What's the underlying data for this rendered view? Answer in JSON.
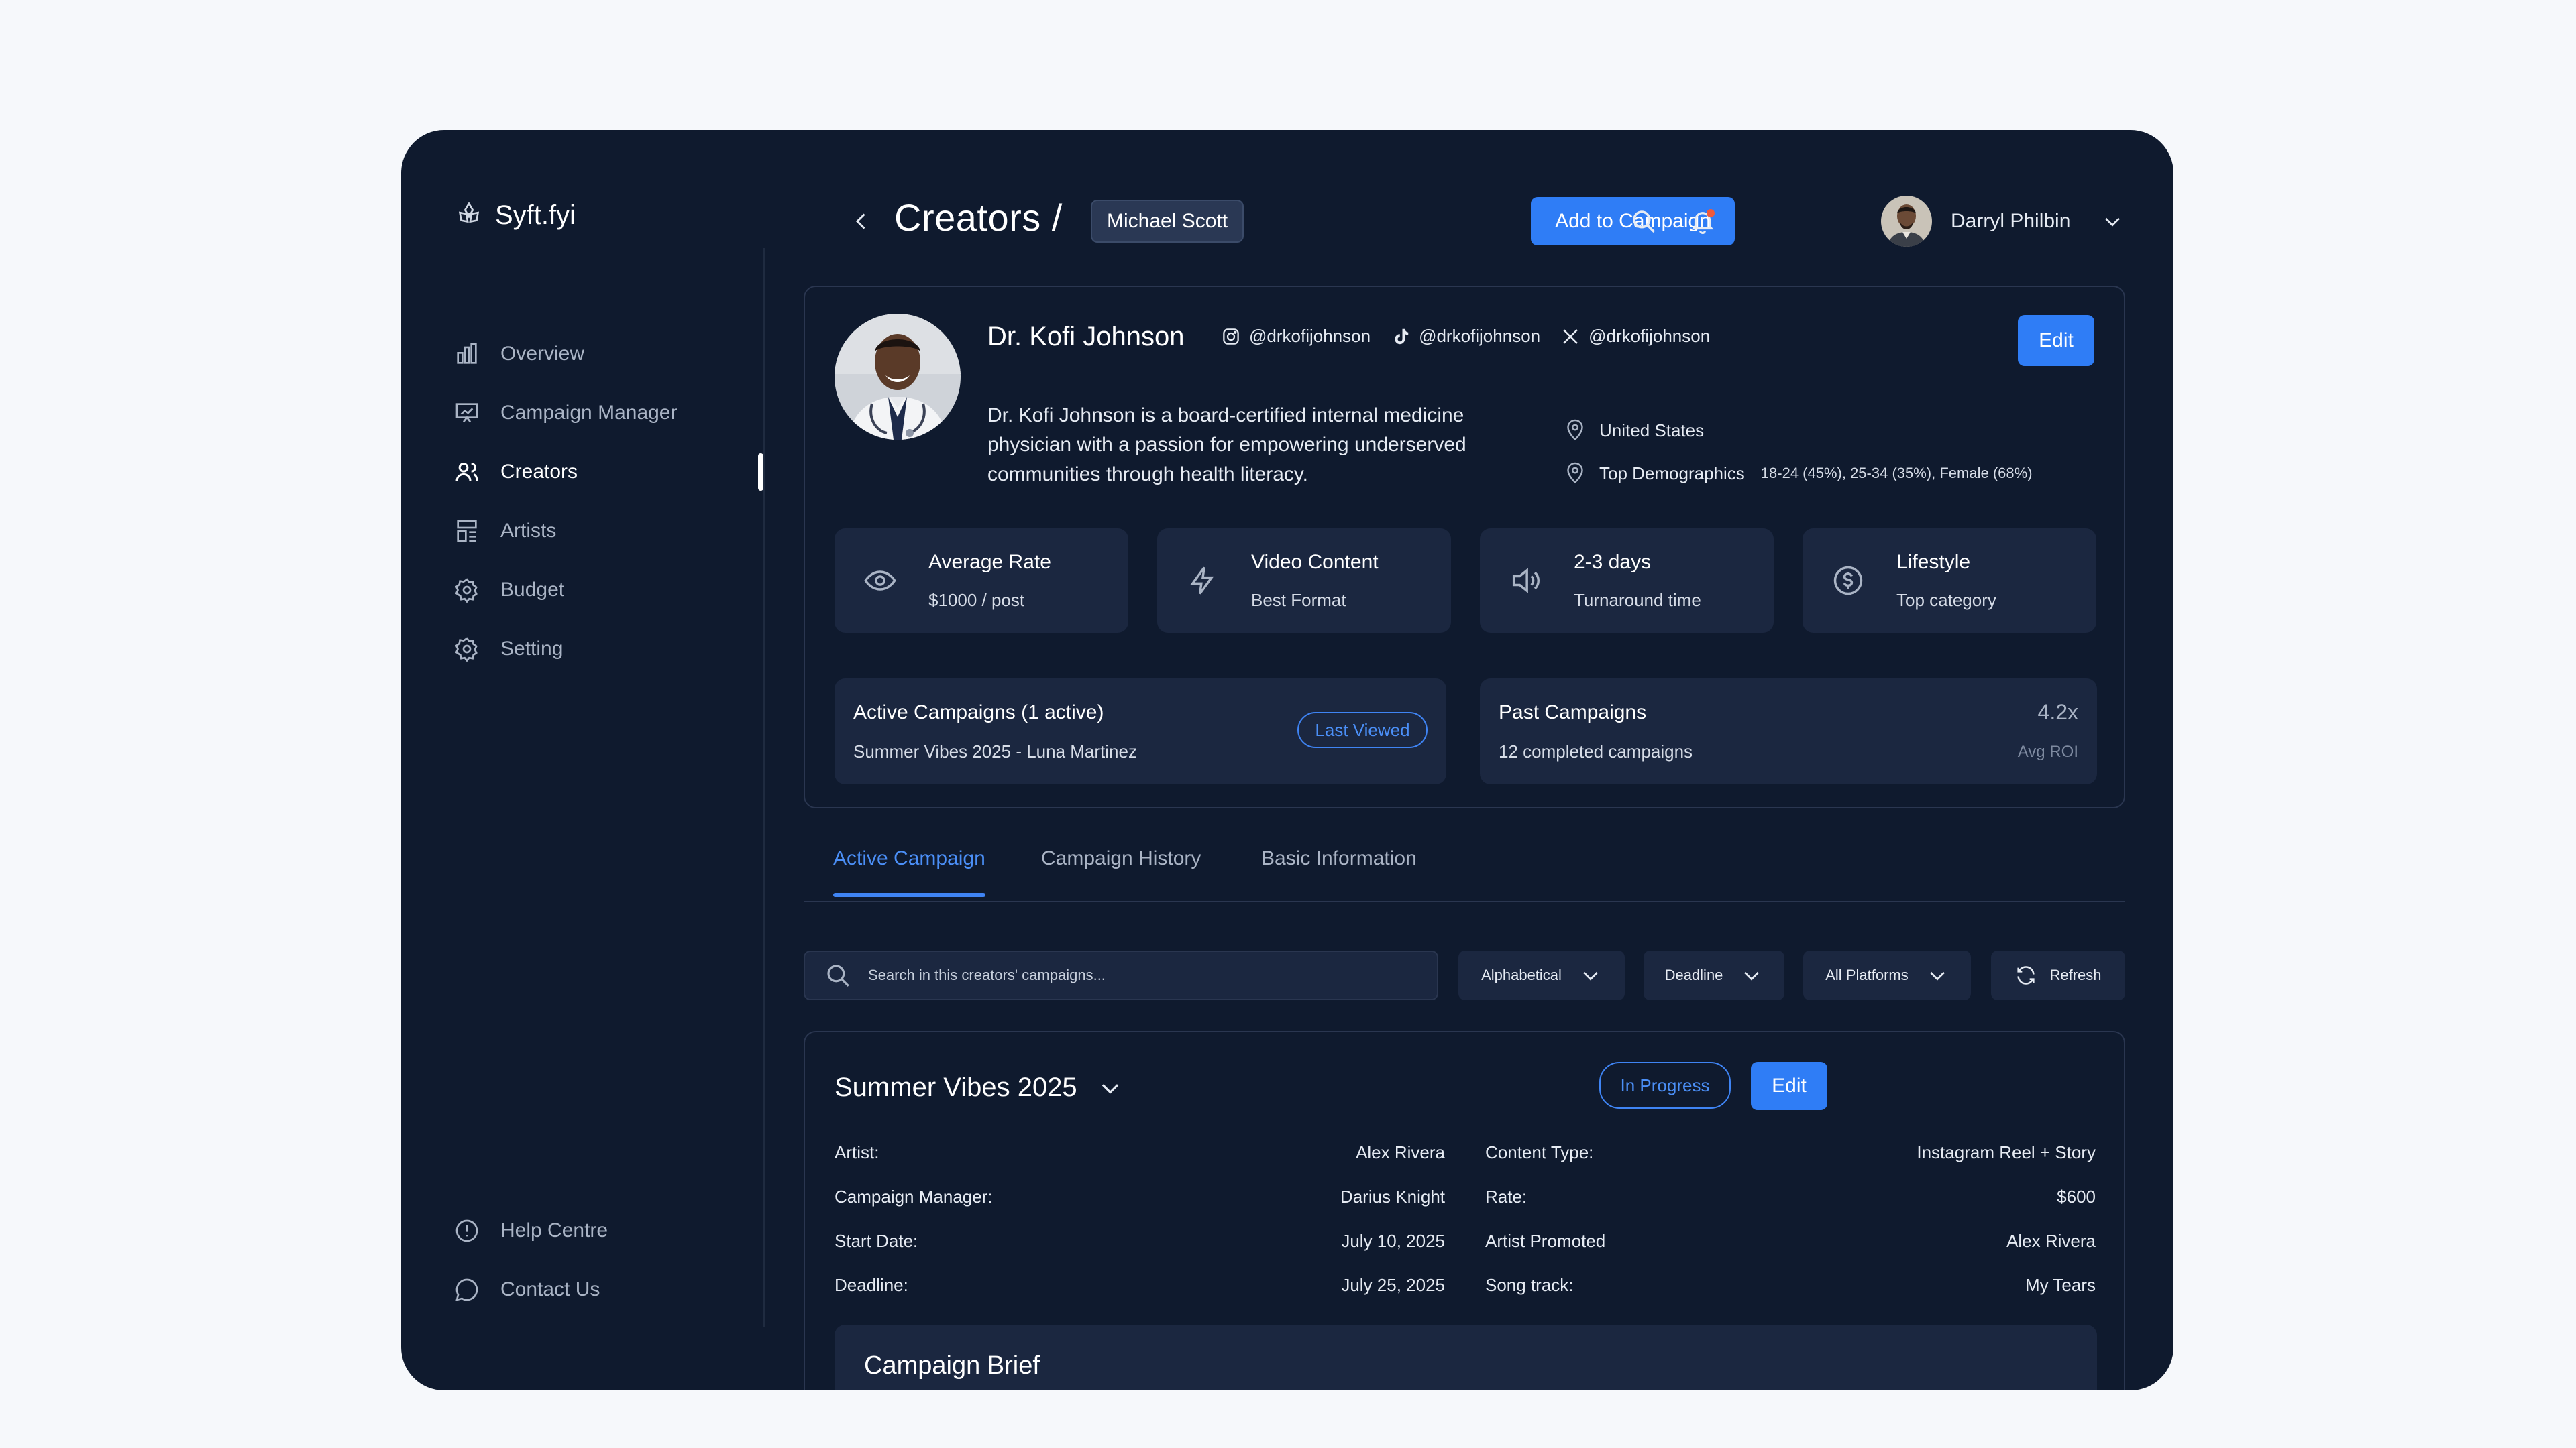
{
  "brand": {
    "name": "Syft.fyi"
  },
  "sidebar": {
    "items": [
      {
        "label": "Overview",
        "icon": "bar-chart-icon"
      },
      {
        "label": "Campaign Manager",
        "icon": "presentation-chart-icon"
      },
      {
        "label": "Creators",
        "icon": "users-icon",
        "active": true
      },
      {
        "label": "Artists",
        "icon": "layout-icon"
      },
      {
        "label": "Budget",
        "icon": "gear-icon"
      },
      {
        "label": "Setting",
        "icon": "gear-icon"
      }
    ],
    "bottom": [
      {
        "label": "Help Centre",
        "icon": "info-icon"
      },
      {
        "label": "Contact Us",
        "icon": "chat-icon"
      }
    ]
  },
  "header": {
    "title": "Creators /",
    "breadcrumb": "Michael Scott",
    "add_button": "Add to Campaign",
    "user_name": "Darryl Philbin"
  },
  "profile": {
    "name": "Dr. Kofi Johnson",
    "socials": {
      "instagram": "@drkofijohnson",
      "tiktok": "@drkofijohnson",
      "x": "@drkofijohnson"
    },
    "edit": "Edit",
    "bio": "Dr. Kofi Johnson is a board-certified internal medicine physician with a passion for empowering underserved communities through health literacy.",
    "location": "United States",
    "demographics_label": "Top Demographics",
    "demographics": "18-24 (45%), 25-34 (35%), Female (68%)",
    "stats": [
      {
        "title": "Average Rate",
        "sub": "$1000 / post",
        "icon": "eye-icon"
      },
      {
        "title": "Video Content",
        "sub": "Best Format",
        "icon": "bolt-icon"
      },
      {
        "title": "2-3 days",
        "sub": "Turnaround time",
        "icon": "speaker-icon"
      },
      {
        "title": "Lifestyle",
        "sub": "Top category",
        "icon": "dollar-circle-icon"
      }
    ],
    "active_campaigns": {
      "title": "Active Campaigns (1 active)",
      "sub": "Summer Vibes 2025 - Luna Martinez",
      "badge": "Last Viewed"
    },
    "past_campaigns": {
      "title": "Past Campaigns",
      "sub": "12 completed campaigns",
      "roi": "4.2x",
      "roi_label": "Avg ROI"
    }
  },
  "tabs": [
    "Active Campaign",
    "Campaign History",
    "Basic Information"
  ],
  "filters": {
    "search_placeholder": "Search in this creators' campaigns...",
    "sort": "Alphabetical",
    "deadline": "Deadline",
    "platforms": "All Platforms",
    "refresh": "Refresh"
  },
  "campaign": {
    "title": "Summer Vibes 2025",
    "status": "In Progress",
    "edit": "Edit",
    "left": [
      {
        "k": "Artist:",
        "v": "Alex Rivera"
      },
      {
        "k": "Campaign Manager:",
        "v": "Darius Knight"
      },
      {
        "k": "Start Date:",
        "v": "July 10, 2025"
      },
      {
        "k": "Deadline:",
        "v": "July 25, 2025"
      }
    ],
    "right": [
      {
        "k": "Content Type:",
        "v": "Instagram Reel + Story"
      },
      {
        "k": "Rate:",
        "v": "$600"
      },
      {
        "k": "Artist Promoted",
        "v": "Alex Rivera"
      },
      {
        "k": "Song track:",
        "v": "My Tears"
      }
    ],
    "brief_title": "Campaign Brief"
  },
  "colors": {
    "accent": "#2f7df6",
    "background": "#0f1a2e",
    "card": "#1b2740"
  }
}
